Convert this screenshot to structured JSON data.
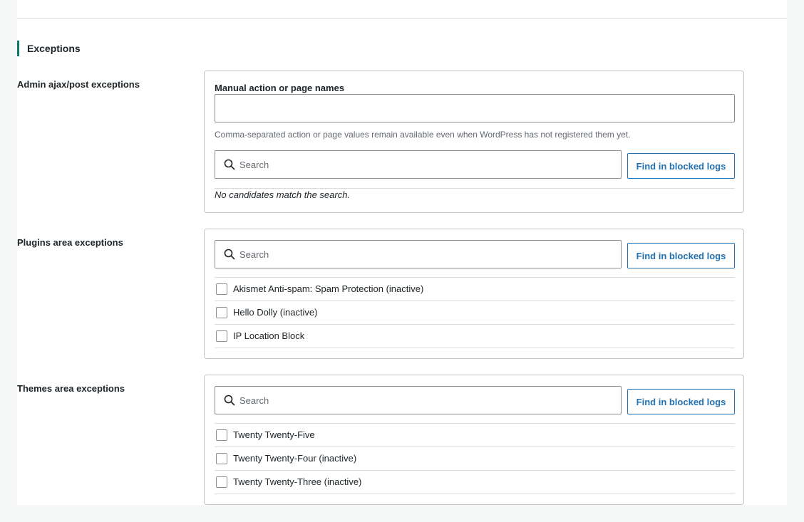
{
  "section": {
    "title": "Exceptions"
  },
  "admin": {
    "label": "Admin ajax/post exceptions",
    "manual_label": "Manual action or page names",
    "manual_value": "",
    "help": "Comma-separated action or page values remain available even when WordPress has not registered them yet.",
    "search_placeholder": "Search",
    "find_button": "Find in blocked logs",
    "empty_message": "No candidates match the search."
  },
  "plugins": {
    "label": "Plugins area exceptions",
    "search_placeholder": "Search",
    "find_button": "Find in blocked logs",
    "items": [
      {
        "label": "Akismet Anti-spam: Spam Protection (inactive)",
        "checked": false
      },
      {
        "label": "Hello Dolly (inactive)",
        "checked": false
      },
      {
        "label": "IP Location Block",
        "checked": false
      }
    ]
  },
  "themes": {
    "label": "Themes area exceptions",
    "search_placeholder": "Search",
    "find_button": "Find in blocked logs",
    "items": [
      {
        "label": "Twenty Twenty-Five",
        "checked": false
      },
      {
        "label": "Twenty Twenty-Four (inactive)",
        "checked": false
      },
      {
        "label": "Twenty Twenty-Three (inactive)",
        "checked": false
      }
    ]
  },
  "icons": {
    "search": "search-icon"
  },
  "colors": {
    "accent": "#0d7a66",
    "link": "#2271b1",
    "border": "#c3c4c7",
    "background": "#f6f7f7"
  }
}
